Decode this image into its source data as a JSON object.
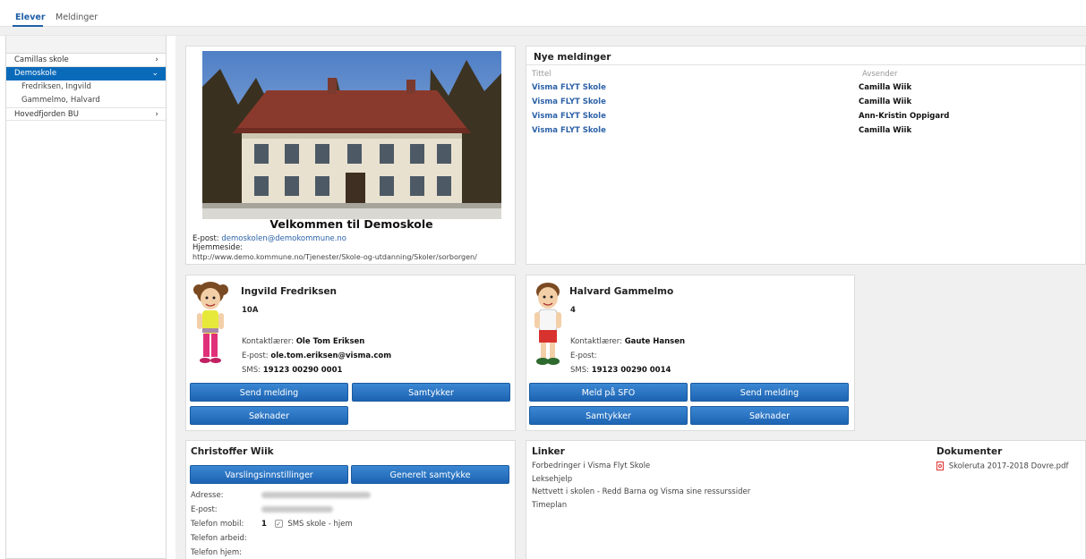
{
  "topnav": {
    "tabs": [
      "Elever",
      "Meldinger"
    ]
  },
  "sidebar": {
    "items": [
      {
        "label": "Camillas skole",
        "chevron": "›"
      },
      {
        "label": "Demoskole",
        "chevron": "⌄"
      }
    ],
    "sub_items": [
      "Fredriksen, Ingvild",
      "Gammelmo, Halvard"
    ],
    "last_item": {
      "label": "Hovedfjorden BU",
      "chevron": "›"
    }
  },
  "school": {
    "welcome": "Velkommen til Demoskole",
    "email_label": "E-post:",
    "email": "demoskolen@demokommune.no",
    "web_label": "Hjemmeside:",
    "web": "http://www.demo.kommune.no/Tjenester/Skole-og-utdanning/Skoler/sorborgen/"
  },
  "messages": {
    "title": "Nye meldinger",
    "col_title": "Tittel",
    "col_sender": "Avsender",
    "rows": [
      {
        "title": "Visma FLYT Skole",
        "sender": "Camilla Wiik"
      },
      {
        "title": "Visma FLYT Skole",
        "sender": "Camilla Wiik"
      },
      {
        "title": "Visma FLYT Skole",
        "sender": "Ann-Kristin Oppigard"
      },
      {
        "title": "Visma FLYT Skole",
        "sender": "Camilla Wiik"
      }
    ]
  },
  "student1": {
    "name": "Ingvild Fredriksen",
    "class": "10A",
    "contact_label": "Kontaktlærer:",
    "contact": "Ole Tom Eriksen",
    "email_label": "E-post:",
    "email": "ole.tom.eriksen@visma.com",
    "sms_label": "SMS:",
    "sms": "19123 00290 0001",
    "buttons": [
      "Send melding",
      "Samtykker",
      "Søknader"
    ]
  },
  "student2": {
    "name": "Halvard Gammelmo",
    "class": "4",
    "contact_label": "Kontaktlærer:",
    "contact": "Gaute Hansen",
    "email_label": "E-post:",
    "sms_label": "SMS:",
    "sms": "19123 00290 0014",
    "buttons": [
      "Meld på SFO",
      "Send melding",
      "Samtykker",
      "Søknader"
    ]
  },
  "parent": {
    "name": "Christoffer Wiik",
    "buttons": [
      "Varslingsinnstillinger",
      "Generelt samtykke"
    ],
    "labels": [
      "Adresse:",
      "E-post:",
      "Telefon mobil:",
      "Telefon arbeid:",
      "Telefon hjem:"
    ],
    "mobile_prefix": "1",
    "sms_check_label": "SMS skole - hjem"
  },
  "links": {
    "title": "Linker",
    "items": [
      "Forbedringer i Visma Flyt Skole",
      "Leksehjelp",
      "Nettvett i skolen - Redd Barna og Visma sine ressurssider",
      "Timeplan"
    ]
  },
  "documents": {
    "title": "Dokumenter",
    "items": [
      "Skoleruta 2017-2018 Dovre.pdf"
    ]
  }
}
